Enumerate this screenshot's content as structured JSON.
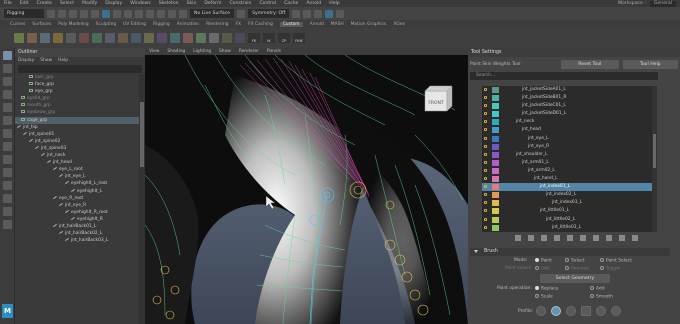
{
  "menubar": {
    "items": [
      "File",
      "Edit",
      "Create",
      "Select",
      "Modify",
      "Display",
      "Windows",
      "Skeleton",
      "Skin",
      "Deform",
      "Constrain",
      "Control",
      "Cache",
      "Arnold",
      "Help"
    ],
    "workspace_label": "Workspace :",
    "workspace_value": "General"
  },
  "statusline": {
    "mode": "Rigging",
    "live_surface": "No Live Surface",
    "symmetry": "Symmetry: Off"
  },
  "shelf": {
    "tabs": [
      "Curves",
      "Surfaces",
      "Poly Modeling",
      "Sculpting",
      "UV Editing",
      "Rigging",
      "Animation",
      "Rendering",
      "FX",
      "FX Caching",
      "Custom",
      "Arnold",
      "MASH",
      "Motion Graphics",
      "XGen"
    ],
    "active_tab": "Custom",
    "labels": [
      "FK",
      "IK",
      "CP",
      "FKIK"
    ]
  },
  "outliner": {
    "title": "Outliner",
    "menu": [
      "Display",
      "Show",
      "Help"
    ],
    "rows": [
      {
        "label": "lash_grp",
        "indent": 14,
        "type": "box",
        "dim": true
      },
      {
        "label": "face_grp",
        "indent": 14,
        "type": "box",
        "dim": false
      },
      {
        "label": "eye_grp",
        "indent": 14,
        "type": "box",
        "dim": false
      },
      {
        "label": "eyelid_grp",
        "indent": 6,
        "type": "box",
        "dim": true
      },
      {
        "label": "mouth_grp",
        "indent": 6,
        "type": "box",
        "dim": true
      },
      {
        "label": "eyebrow_grp",
        "indent": 6,
        "type": "box",
        "dim": true
      },
      {
        "label": "cage_grp",
        "indent": 6,
        "type": "box",
        "dim": false,
        "selected": true
      },
      {
        "label": "jnt_hip",
        "indent": 2,
        "type": "bone",
        "dim": false
      },
      {
        "label": "jnt_spine01",
        "indent": 8,
        "type": "bone",
        "dim": false
      },
      {
        "label": "jnt_spine02",
        "indent": 14,
        "type": "bone",
        "dim": false
      },
      {
        "label": "jnt_spine03",
        "indent": 20,
        "type": "bone",
        "dim": false
      },
      {
        "label": "jnt_neck",
        "indent": 26,
        "type": "bone",
        "dim": false
      },
      {
        "label": "jnt_head",
        "indent": 32,
        "type": "bone",
        "dim": false
      },
      {
        "label": "eye_L_root",
        "indent": 38,
        "type": "bone",
        "dim": false
      },
      {
        "label": "jnt_eye_L",
        "indent": 44,
        "type": "bone",
        "dim": false
      },
      {
        "label": "eyehighlt_L_root",
        "indent": 50,
        "type": "bone",
        "dim": false
      },
      {
        "label": "eyehighlt_L",
        "indent": 56,
        "type": "bone",
        "dim": false
      },
      {
        "label": "eye_R_root",
        "indent": 38,
        "type": "bone",
        "dim": false
      },
      {
        "label": "jnt_eye_R",
        "indent": 44,
        "type": "bone",
        "dim": false
      },
      {
        "label": "eyehighlt_R_root",
        "indent": 50,
        "type": "bone",
        "dim": false
      },
      {
        "label": "eyehighlt_R",
        "indent": 56,
        "type": "bone",
        "dim": false
      },
      {
        "label": "jnt_hairBack01_L",
        "indent": 38,
        "type": "bone",
        "dim": false
      },
      {
        "label": "jnt_hairBack02_L",
        "indent": 44,
        "type": "bone",
        "dim": false
      },
      {
        "label": "jnt_hairBack03_L",
        "indent": 50,
        "type": "bone",
        "dim": false
      }
    ]
  },
  "viewport": {
    "menu": [
      "View",
      "Shading",
      "Lighting",
      "Show",
      "Renderer",
      "Panels"
    ],
    "viewcube_label": "FRONT"
  },
  "tool_settings": {
    "title": "Tool Settings",
    "tool_name": "Paint Skin Weights Tool",
    "reset_label": "Reset Tool",
    "help_label": "Tool Help",
    "search_placeholder": "Search...",
    "influences": [
      {
        "name": "jnt_jacketSideA01_L",
        "indent": 40,
        "color": "#5a9a8e"
      },
      {
        "name": "jnt_jacketSideB01_R",
        "indent": 40,
        "color": "#4db3a0"
      },
      {
        "name": "jnt_jacketSideC01_L",
        "indent": 40,
        "color": "#4cc6b8"
      },
      {
        "name": "jnt_jacketSideD01_L",
        "indent": 40,
        "color": "#44c7c9"
      },
      {
        "name": "jnt_neck",
        "indent": 34,
        "color": "#2eaab8"
      },
      {
        "name": "jnt_head",
        "indent": 40,
        "color": "#3f9ed0"
      },
      {
        "name": "jnt_eye_L",
        "indent": 46,
        "color": "#3c78c4"
      },
      {
        "name": "jnt_eye_R",
        "indent": 46,
        "color": "#6a5ac8"
      },
      {
        "name": "jnt_shoulder_L",
        "indent": 34,
        "color": "#8a57c7"
      },
      {
        "name": "jnt_arm01_L",
        "indent": 40,
        "color": "#b05fc8"
      },
      {
        "name": "jnt_arm02_L",
        "indent": 46,
        "color": "#c86cc2"
      },
      {
        "name": "jnt_hand_L",
        "indent": 52,
        "color": "#d279ad"
      },
      {
        "name": "jnt_index01_L",
        "indent": 58,
        "color": "#dd7f7f",
        "selected": true
      },
      {
        "name": "jnt_index02_L",
        "indent": 64,
        "color": "#e09a55"
      },
      {
        "name": "jnt_index03_L",
        "indent": 70,
        "color": "#e0b84c"
      },
      {
        "name": "jnt_littlle01_L",
        "indent": 58,
        "color": "#d8c74e"
      },
      {
        "name": "jnt_littlle02_L",
        "indent": 64,
        "color": "#b8cc52"
      },
      {
        "name": "jnt_littlle03_L",
        "indent": 70,
        "color": "#8ec85a"
      }
    ],
    "brush": {
      "section": "Brush",
      "mode_label": "Mode:",
      "mode_options": [
        "Paint",
        "Select",
        "Paint Select"
      ],
      "paint_select_label": "Paint select:",
      "paint_select_options": [
        "Add",
        "Remove",
        "Toggle"
      ],
      "select_geometry": "Select Geometry",
      "paint_operation_label": "Paint operation:",
      "paint_operations": [
        "Replace",
        "Add",
        "Scale",
        "Smooth"
      ],
      "profile_label": "Profile:"
    }
  },
  "colors": {
    "accent_blue": "#5285a6",
    "lock_yellow": "#d6b03a",
    "logo_blue": "#2e8ec2"
  }
}
